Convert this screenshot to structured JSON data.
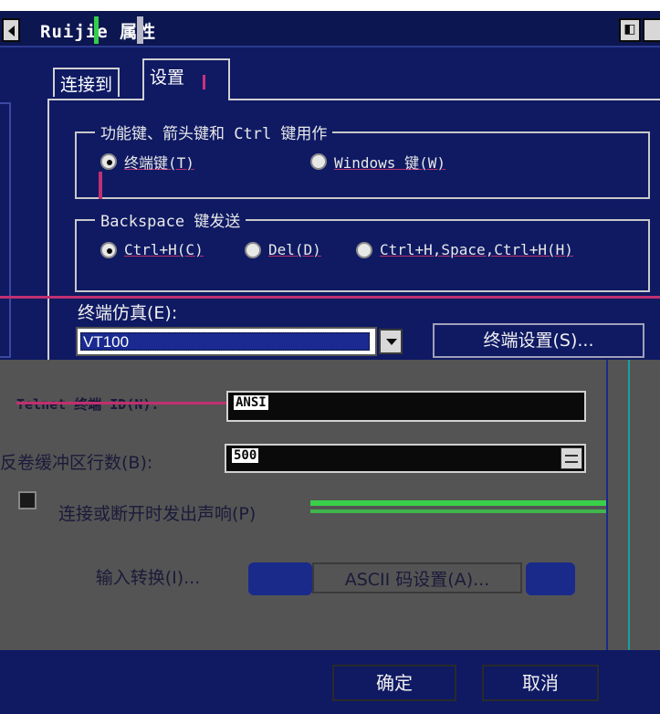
{
  "window": {
    "title": "Ruijie 属性",
    "tb_btn_1": "◧",
    "tb_btn_2": ""
  },
  "tabs": [
    {
      "label": "连接到"
    },
    {
      "label": "设置"
    }
  ],
  "function_keys_group": {
    "legend": "功能键、箭头键和 Ctrl 键用作",
    "options": [
      {
        "label": "终端键(T)",
        "selected": true
      },
      {
        "label": "Windows 键(W)",
        "selected": false
      }
    ]
  },
  "backspace_group": {
    "legend": "Backspace 键发送",
    "options": [
      {
        "label": "Ctrl+H(C)",
        "selected": true
      },
      {
        "label": "Del(D)",
        "selected": false
      },
      {
        "label": "Ctrl+H,Space,Ctrl+H(H)",
        "selected": false
      }
    ]
  },
  "emulation": {
    "label": "终端仿真(E):",
    "selected": "VT100",
    "settings_button": "终端设置(S)..."
  },
  "telnet": {
    "label": "Telnet 终端 ID(N):",
    "value": "ANSI"
  },
  "backscroll": {
    "label": "反卷缓冲区行数(B):",
    "value": "500"
  },
  "beep_checkbox": {
    "label": "连接或断开时发出声响(P)",
    "checked": false
  },
  "buttons": {
    "input_translation": "输入转换(I)...",
    "ascii_setup": "ASCII 码设置(A)...",
    "ok": "确定",
    "cancel": "取消"
  }
}
